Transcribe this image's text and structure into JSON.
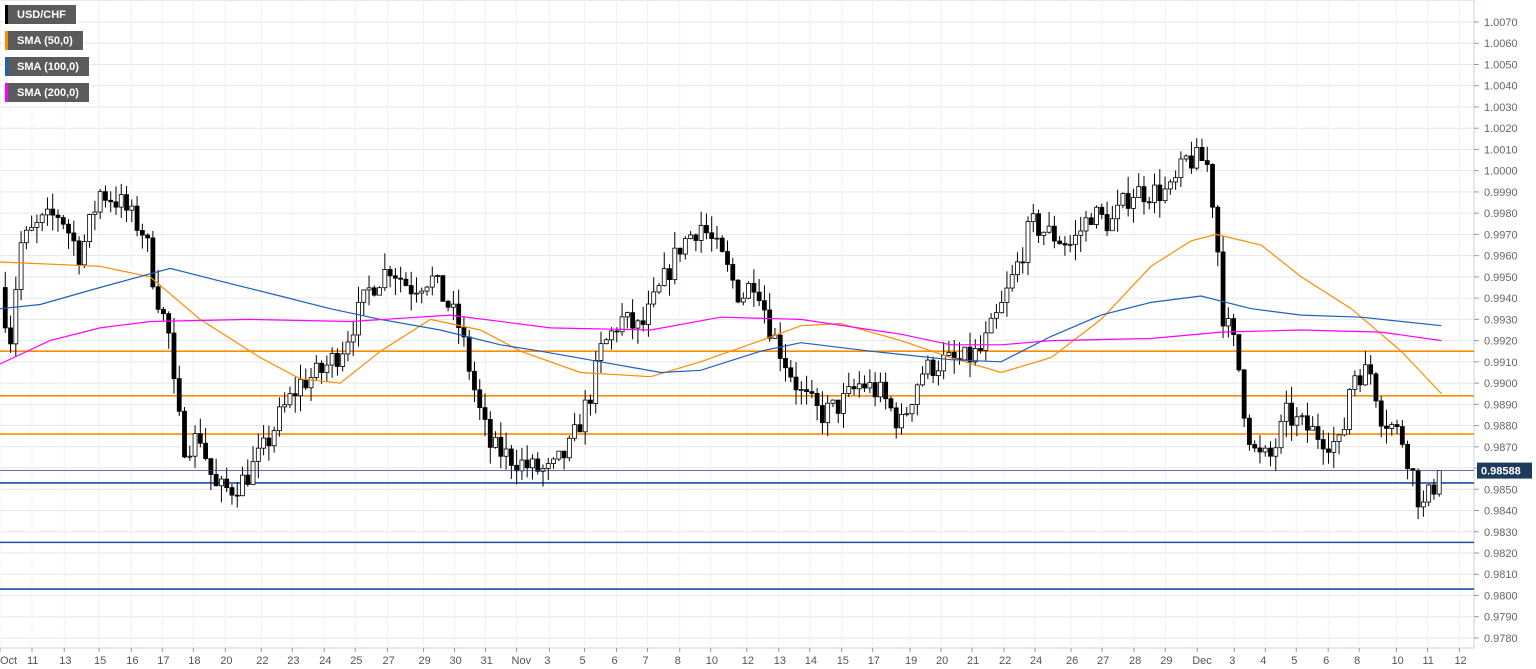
{
  "legend": [
    {
      "label": "USD/CHF",
      "color": "#000000"
    },
    {
      "label": "SMA (50,0)",
      "color": "#ff8c00"
    },
    {
      "label": "SMA (100,0)",
      "color": "#1f5fbf"
    },
    {
      "label": "SMA (200,0)",
      "color": "#ff00ff"
    }
  ],
  "chart_data": {
    "type": "candlestick",
    "symbol": "USD/CHF",
    "timeframe": "4h",
    "xlim": [
      0,
      46.6
    ],
    "ylim": [
      0.9775,
      1.008
    ],
    "y_ticks": [
      "1.0070",
      "1.0060",
      "1.0050",
      "1.0040",
      "1.0030",
      "1.0020",
      "1.0010",
      "1.0000",
      "0.9990",
      "0.9980",
      "0.9970",
      "0.9960",
      "0.9950",
      "0.9940",
      "0.9930",
      "0.9920",
      "0.9910",
      "0.9900",
      "0.9890",
      "0.9880",
      "0.9870",
      "0.9860",
      "0.9850",
      "0.9840",
      "0.9830",
      "0.9820",
      "0.9810",
      "0.9800",
      "0.9790",
      "0.9780"
    ],
    "x_ticks": [
      {
        "t": 0,
        "label": "Oct"
      },
      {
        "t": 1.01,
        "label": "11"
      },
      {
        "t": 2.03,
        "label": "13"
      },
      {
        "t": 3.13,
        "label": "15"
      },
      {
        "t": 4.15,
        "label": "16"
      },
      {
        "t": 5.13,
        "label": "17"
      },
      {
        "t": 6.11,
        "label": "18"
      },
      {
        "t": 7.12,
        "label": "20"
      },
      {
        "t": 8.26,
        "label": "22"
      },
      {
        "t": 9.24,
        "label": "23"
      },
      {
        "t": 10.25,
        "label": "24"
      },
      {
        "t": 11.23,
        "label": "25"
      },
      {
        "t": 12.25,
        "label": "27"
      },
      {
        "t": 13.39,
        "label": "29"
      },
      {
        "t": 14.37,
        "label": "30"
      },
      {
        "t": 15.35,
        "label": "31"
      },
      {
        "t": 16.33,
        "label": "Nov"
      },
      {
        "t": 17.37,
        "label": "3"
      },
      {
        "t": 18.48,
        "label": "5"
      },
      {
        "t": 19.49,
        "label": "6"
      },
      {
        "t": 20.47,
        "label": "7"
      },
      {
        "t": 21.49,
        "label": "8"
      },
      {
        "t": 22.47,
        "label": "10"
      },
      {
        "t": 23.61,
        "label": "12"
      },
      {
        "t": 24.62,
        "label": "13"
      },
      {
        "t": 25.6,
        "label": "14"
      },
      {
        "t": 26.61,
        "label": "15"
      },
      {
        "t": 27.59,
        "label": "17"
      },
      {
        "t": 28.77,
        "label": "19"
      },
      {
        "t": 29.75,
        "label": "20"
      },
      {
        "t": 30.73,
        "label": "21"
      },
      {
        "t": 31.74,
        "label": "22"
      },
      {
        "t": 32.72,
        "label": "24"
      },
      {
        "t": 33.86,
        "label": "26"
      },
      {
        "t": 34.84,
        "label": "27"
      },
      {
        "t": 35.85,
        "label": "28"
      },
      {
        "t": 36.84,
        "label": "29"
      },
      {
        "t": 37.85,
        "label": "Dec"
      },
      {
        "t": 39.02,
        "label": "3"
      },
      {
        "t": 40.0,
        "label": "4"
      },
      {
        "t": 40.98,
        "label": "5"
      },
      {
        "t": 41.99,
        "label": "6"
      },
      {
        "t": 42.97,
        "label": "8"
      },
      {
        "t": 44.15,
        "label": "10"
      },
      {
        "t": 45.13,
        "label": "11"
      },
      {
        "t": 46.14,
        "label": "12"
      }
    ],
    "current_price": "0.98588",
    "price_path": [
      [
        0,
        0.9945
      ],
      [
        0.32,
        0.992
      ],
      [
        0.63,
        0.9965
      ],
      [
        1.27,
        0.9975
      ],
      [
        1.9,
        0.998
      ],
      [
        2.53,
        0.996
      ],
      [
        3.16,
        0.999
      ],
      [
        3.8,
        0.9985
      ],
      [
        4.59,
        0.997
      ],
      [
        4.9,
        0.9945
      ],
      [
        5.38,
        0.992
      ],
      [
        5.54,
        0.989
      ],
      [
        5.85,
        0.987
      ],
      [
        6.33,
        0.9875
      ],
      [
        6.8,
        0.985
      ],
      [
        7.28,
        0.985
      ],
      [
        7.75,
        0.9855
      ],
      [
        8.39,
        0.987
      ],
      [
        8.86,
        0.9885
      ],
      [
        9.49,
        0.99
      ],
      [
        10.13,
        0.9905
      ],
      [
        10.76,
        0.9915
      ],
      [
        11.08,
        0.9925
      ],
      [
        11.71,
        0.9945
      ],
      [
        12.34,
        0.9955
      ],
      [
        12.97,
        0.9945
      ],
      [
        13.61,
        0.995
      ],
      [
        14.24,
        0.9935
      ],
      [
        14.56,
        0.9925
      ],
      [
        14.87,
        0.9905
      ],
      [
        15.19,
        0.9885
      ],
      [
        15.51,
        0.987
      ],
      [
        16.14,
        0.9865
      ],
      [
        16.77,
        0.986
      ],
      [
        17.41,
        0.9858
      ],
      [
        18.04,
        0.987
      ],
      [
        18.67,
        0.9895
      ],
      [
        18.99,
        0.9915
      ],
      [
        19.62,
        0.993
      ],
      [
        20.25,
        0.9925
      ],
      [
        20.89,
        0.9945
      ],
      [
        21.52,
        0.9965
      ],
      [
        22.15,
        0.9975
      ],
      [
        22.78,
        0.996
      ],
      [
        23.42,
        0.994
      ],
      [
        23.89,
        0.995
      ],
      [
        24.37,
        0.9925
      ],
      [
        24.84,
        0.991
      ],
      [
        25.32,
        0.9895
      ],
      [
        25.95,
        0.9885
      ],
      [
        26.58,
        0.989
      ],
      [
        27.22,
        0.99
      ],
      [
        27.85,
        0.9895
      ],
      [
        28.48,
        0.988
      ],
      [
        29.11,
        0.9905
      ],
      [
        29.75,
        0.991
      ],
      [
        30.38,
        0.991
      ],
      [
        31.01,
        0.9915
      ],
      [
        31.65,
        0.9935
      ],
      [
        32.28,
        0.996
      ],
      [
        32.6,
        0.9975
      ],
      [
        33.23,
        0.997
      ],
      [
        33.87,
        0.9965
      ],
      [
        34.5,
        0.998
      ],
      [
        35.13,
        0.9975
      ],
      [
        35.76,
        0.999
      ],
      [
        36.4,
        0.999
      ],
      [
        37.03,
        0.999
      ],
      [
        37.5,
        1.0005
      ],
      [
        38.14,
        1.0005
      ],
      [
        38.45,
        0.9975
      ],
      [
        38.61,
        0.9935
      ],
      [
        39.09,
        0.9915
      ],
      [
        39.41,
        0.988
      ],
      [
        39.72,
        0.9865
      ],
      [
        40.2,
        0.9865
      ],
      [
        40.67,
        0.9885
      ],
      [
        41.15,
        0.988
      ],
      [
        41.78,
        0.9875
      ],
      [
        42.41,
        0.987
      ],
      [
        42.73,
        0.9905
      ],
      [
        43.36,
        0.9905
      ],
      [
        43.67,
        0.9885
      ],
      [
        44.3,
        0.9875
      ],
      [
        44.62,
        0.986
      ],
      [
        44.94,
        0.984
      ],
      [
        45.57,
        0.98588
      ]
    ],
    "series": [
      {
        "name": "SMA (50,0)",
        "color": "#ff8c00",
        "points": [
          [
            0,
            0.9957
          ],
          [
            3.16,
            0.9955
          ],
          [
            4.75,
            0.995
          ],
          [
            6.33,
            0.993
          ],
          [
            8.23,
            0.9912
          ],
          [
            9.49,
            0.9902
          ],
          [
            10.76,
            0.99
          ],
          [
            12.03,
            0.9915
          ],
          [
            13.61,
            0.993
          ],
          [
            15.19,
            0.9925
          ],
          [
            16.46,
            0.9915
          ],
          [
            18.35,
            0.9905
          ],
          [
            20.57,
            0.9903
          ],
          [
            22.15,
            0.991
          ],
          [
            24.05,
            0.992
          ],
          [
            25.32,
            0.9927
          ],
          [
            26.58,
            0.9928
          ],
          [
            28.48,
            0.992
          ],
          [
            30.06,
            0.9912
          ],
          [
            31.65,
            0.9905
          ],
          [
            33.23,
            0.9912
          ],
          [
            34.81,
            0.993
          ],
          [
            36.39,
            0.9955
          ],
          [
            37.66,
            0.9967
          ],
          [
            38.45,
            0.997
          ],
          [
            39.87,
            0.9965
          ],
          [
            41.14,
            0.995
          ],
          [
            42.72,
            0.9935
          ],
          [
            44.3,
            0.9915
          ],
          [
            45.57,
            0.9895
          ]
        ]
      },
      {
        "name": "SMA (100,0)",
        "color": "#1f5fbf",
        "points": [
          [
            0,
            0.9935
          ],
          [
            1.27,
            0.9937
          ],
          [
            3.16,
            0.9945
          ],
          [
            5.38,
            0.9954
          ],
          [
            6.96,
            0.9948
          ],
          [
            8.86,
            0.9941
          ],
          [
            10.44,
            0.9935
          ],
          [
            12.03,
            0.993
          ],
          [
            13.92,
            0.9925
          ],
          [
            15.82,
            0.9918
          ],
          [
            17.09,
            0.9915
          ],
          [
            18.99,
            0.991
          ],
          [
            20.89,
            0.9905
          ],
          [
            22.15,
            0.9906
          ],
          [
            24.05,
            0.9915
          ],
          [
            25.32,
            0.9919
          ],
          [
            27.53,
            0.9915
          ],
          [
            30.06,
            0.9911
          ],
          [
            31.65,
            0.991
          ],
          [
            33.23,
            0.9922
          ],
          [
            34.81,
            0.9932
          ],
          [
            36.39,
            0.9938
          ],
          [
            37.97,
            0.9941
          ],
          [
            39.56,
            0.9935
          ],
          [
            41.14,
            0.9932
          ],
          [
            43.04,
            0.9931
          ],
          [
            45.57,
            0.9927
          ]
        ]
      },
      {
        "name": "SMA (200,0)",
        "color": "#ff00ff",
        "points": [
          [
            0,
            0.9909
          ],
          [
            1.58,
            0.992
          ],
          [
            3.16,
            0.9926
          ],
          [
            4.75,
            0.9929
          ],
          [
            7.91,
            0.993
          ],
          [
            11.08,
            0.9929
          ],
          [
            14.24,
            0.9932
          ],
          [
            17.41,
            0.9926
          ],
          [
            20.57,
            0.9925
          ],
          [
            22.78,
            0.9931
          ],
          [
            25.32,
            0.993
          ],
          [
            28.48,
            0.9923
          ],
          [
            30.06,
            0.9918
          ],
          [
            31.65,
            0.9918
          ],
          [
            33.23,
            0.992
          ],
          [
            36.39,
            0.9921
          ],
          [
            38.61,
            0.9924
          ],
          [
            41.14,
            0.9925
          ],
          [
            43.67,
            0.9924
          ],
          [
            45.57,
            0.992
          ]
        ]
      }
    ],
    "horizontal_levels": [
      {
        "value": 0.9915,
        "color": "#ff8c00"
      },
      {
        "value": 0.9894,
        "color": "#ff8c00"
      },
      {
        "value": 0.9876,
        "color": "#ff8c00"
      },
      {
        "value": 0.9853,
        "color": "#1e4fa0"
      },
      {
        "value": 0.9825,
        "color": "#1e4fa0"
      },
      {
        "value": 0.9803,
        "color": "#1e4fa0"
      }
    ]
  }
}
